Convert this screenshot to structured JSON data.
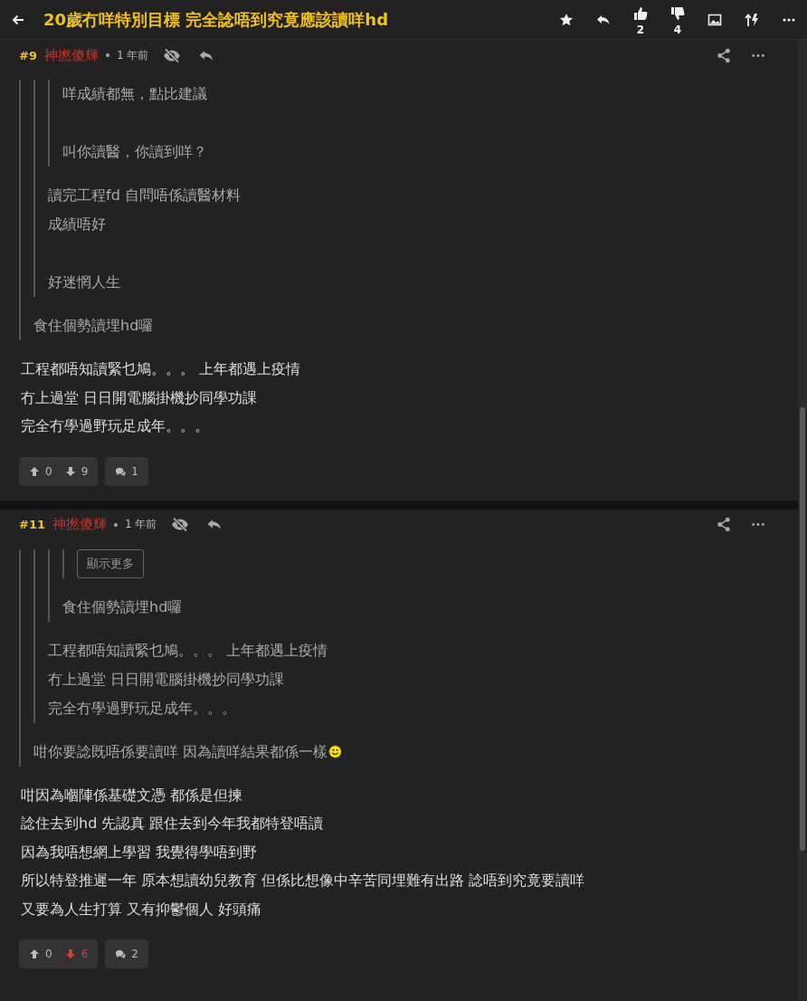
{
  "header": {
    "title": "20歲冇咩特別目標 完全諗唔到究竟應該讀咩hd",
    "likes": "2",
    "dislikes": "4"
  },
  "posts": [
    {
      "number": "#9",
      "author": "神撚傻輝",
      "time": "1 年前",
      "quote": {
        "paragraphs": [
          [
            "食住個勢讀埋hd囉"
          ]
        ],
        "quote": {
          "paragraphs": [
            [
              "讀完工程fd 自問唔係讀醫材料",
              "成績唔好"
            ],
            [
              "好迷惘人生"
            ]
          ],
          "quote": {
            "paragraphs": [
              [
                "咩成績都無，點比建議"
              ],
              [
                "叫你讀醫，你讀到咩？"
              ]
            ]
          }
        }
      },
      "body": [
        "工程都唔知讀緊乜鳩。。。 上年都遇上疫情",
        "冇上過堂 日日開電腦掛機抄同學功課",
        "完全冇學過野玩足成年。。。"
      ],
      "upvotes": "0",
      "downvotes": "9",
      "down_highlighted": false,
      "replies": "1"
    },
    {
      "number": "#11",
      "author": "神撚傻輝",
      "time": "1 年前",
      "quote": {
        "paragraphs": [
          [
            "咁你要諗既唔係要讀咩 因為讀咩結果都係一樣"
          ]
        ],
        "trailing_smiley": true,
        "quote": {
          "paragraphs": [
            [
              "工程都唔知讀緊乜鳩。。。 上年都遇上疫情",
              "冇上過堂 日日開電腦掛機抄同學功課",
              "完全冇學過野玩足成年。。。"
            ]
          ],
          "quote": {
            "paragraphs": [
              [
                "食住個勢讀埋hd囉"
              ]
            ],
            "quote": {
              "show_more": "顯示更多"
            }
          }
        }
      },
      "body": [
        "咁因為嗰陣係基礎文憑 都係是但揀",
        "諗住去到hd 先認真 跟住去到今年我都特登唔讀",
        "因為我唔想網上學習 我覺得學唔到野",
        "所以特登推遲一年 原本想讀幼兒教育 但係比想像中辛苦同埋難有出路 諗唔到究竟要讀咩",
        "又要為人生打算 又有抑鬱個人 好頭痛"
      ],
      "upvotes": "0",
      "downvotes": "6",
      "down_highlighted": true,
      "replies": "2"
    }
  ]
}
